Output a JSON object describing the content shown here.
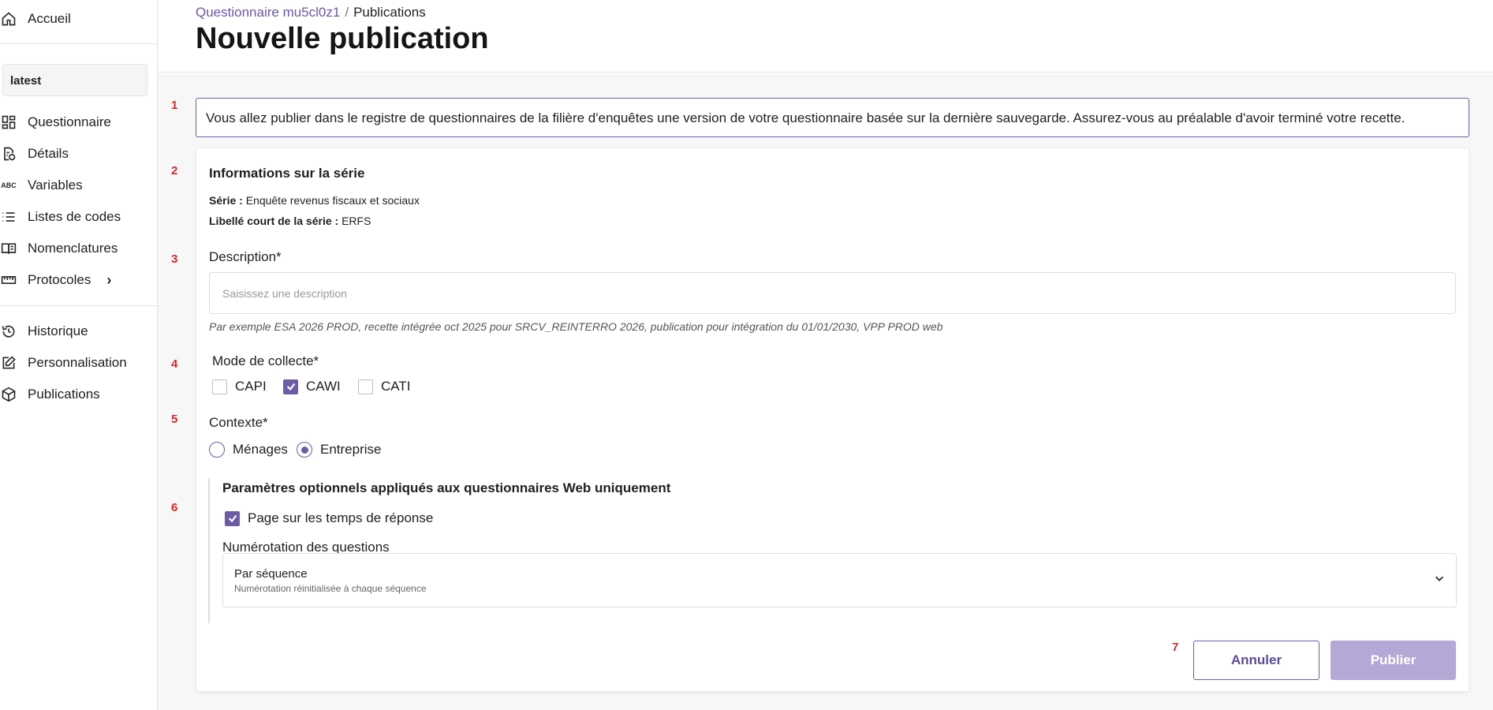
{
  "sidebar": {
    "home_label": "Accueil",
    "version": "latest",
    "items": [
      {
        "label": "Questionnaire",
        "icon": "dashboard-icon"
      },
      {
        "label": "Détails",
        "icon": "file-info-icon"
      },
      {
        "label": "Variables",
        "icon": "abc-icon"
      },
      {
        "label": "Listes de codes",
        "icon": "list-icon"
      },
      {
        "label": "Nomenclatures",
        "icon": "book-icon"
      },
      {
        "label": "Protocoles",
        "icon": "ruler-icon",
        "chevron": "›"
      }
    ],
    "items2": [
      {
        "label": "Historique",
        "icon": "history-icon"
      },
      {
        "label": "Personnalisation",
        "icon": "edit-icon"
      },
      {
        "label": "Publications",
        "icon": "package-icon"
      }
    ]
  },
  "header": {
    "breadcrumb_link": "Questionnaire mu5cl0z1",
    "breadcrumb_sep": "/",
    "breadcrumb_current": "Publications",
    "title": "Nouvelle publication"
  },
  "steps": [
    "1",
    "2",
    "3",
    "4",
    "5",
    "6",
    "7"
  ],
  "banner": "Vous allez publier dans le registre de questionnaires de la filière d'enquêtes une version de votre questionnaire basée sur la dernière sauvegarde. Assurez-vous au préalable d'avoir terminé votre recette.",
  "serie": {
    "title": "Informations sur la série",
    "serie_label": "Série :",
    "serie_value": "Enquête revenus fiscaux et sociaux",
    "short_label": "Libellé court de la série :",
    "short_value": "ERFS"
  },
  "description": {
    "label": "Description*",
    "placeholder": "Saisissez une description",
    "value": "",
    "hint": "Par exemple ESA 2026 PROD, recette intégrée oct 2025 pour SRCV_REINTERRO 2026, publication pour intégration du 01/01/2030, VPP PROD web"
  },
  "collecte": {
    "label": "Mode de collecte*",
    "options": [
      {
        "label": "CAPI",
        "checked": false
      },
      {
        "label": "CAWI",
        "checked": true
      },
      {
        "label": "CATI",
        "checked": false
      }
    ]
  },
  "contexte": {
    "label": "Contexte*",
    "options": [
      {
        "label": "Ménages",
        "selected": false
      },
      {
        "label": "Entreprise",
        "selected": true
      }
    ]
  },
  "optional": {
    "title": "Paramètres optionnels appliqués aux questionnaires Web uniquement",
    "response_time_label": "Page sur les temps de réponse",
    "response_time_checked": true,
    "numbering_label": "Numérotation des questions",
    "numbering_value": "Par séquence",
    "numbering_desc": "Numérotation réinitialisée à chaque séquence"
  },
  "actions": {
    "cancel": "Annuler",
    "publish": "Publier"
  },
  "colors": {
    "accent": "#6d5ba8",
    "accent_disabled": "#b3a8d6",
    "step_marker": "#d9262b"
  }
}
